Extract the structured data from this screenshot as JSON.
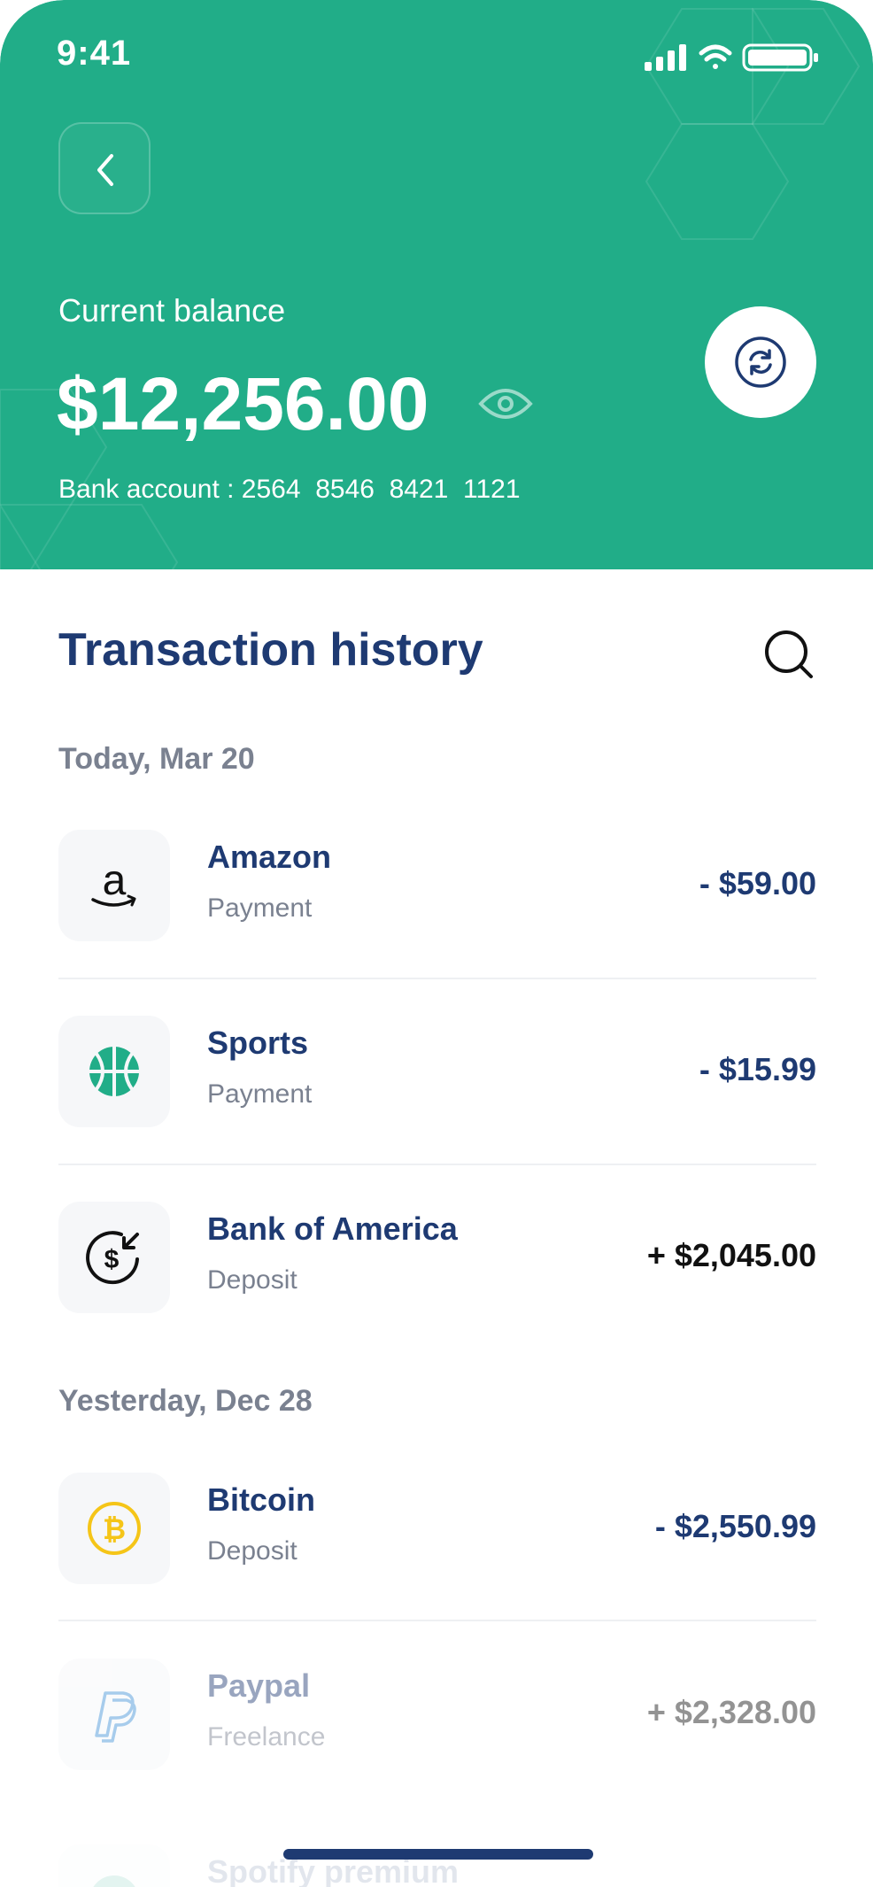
{
  "status_bar": {
    "time": "9:41"
  },
  "header": {
    "balance_label": "Current balance",
    "balance_amount": "$12,256.00",
    "bank_account": "Bank account : 2564  8546  8421  1121"
  },
  "history": {
    "title": "Transaction history",
    "groups": [
      {
        "date": "Today, Mar 20",
        "items": [
          {
            "name": "Amazon",
            "type": "Payment",
            "amount": "- $59.00",
            "icon": "amazon-icon"
          },
          {
            "name": "Sports",
            "type": "Payment",
            "amount": "- $15.99",
            "icon": "basketball-icon"
          },
          {
            "name": "Bank of America",
            "type": "Deposit",
            "amount": "+ $2,045.00",
            "icon": "dollar-refund-icon"
          }
        ]
      },
      {
        "date": "Yesterday, Dec 28",
        "items": [
          {
            "name": "Bitcoin",
            "type": "Deposit",
            "amount": "- $2,550.99",
            "icon": "bitcoin-icon"
          },
          {
            "name": "Paypal",
            "type": "Freelance",
            "amount": "+ $2,328.00",
            "icon": "paypal-icon"
          },
          {
            "name": "Spotify premium",
            "type": "",
            "amount": "",
            "icon": "spotify-icon"
          }
        ]
      }
    ]
  },
  "colors": {
    "header": "#21ad88",
    "primary_text": "#1e3a72",
    "secondary_text": "#7a8190",
    "bitcoin": "#f5c518",
    "paypal": "#3d8fd6"
  }
}
